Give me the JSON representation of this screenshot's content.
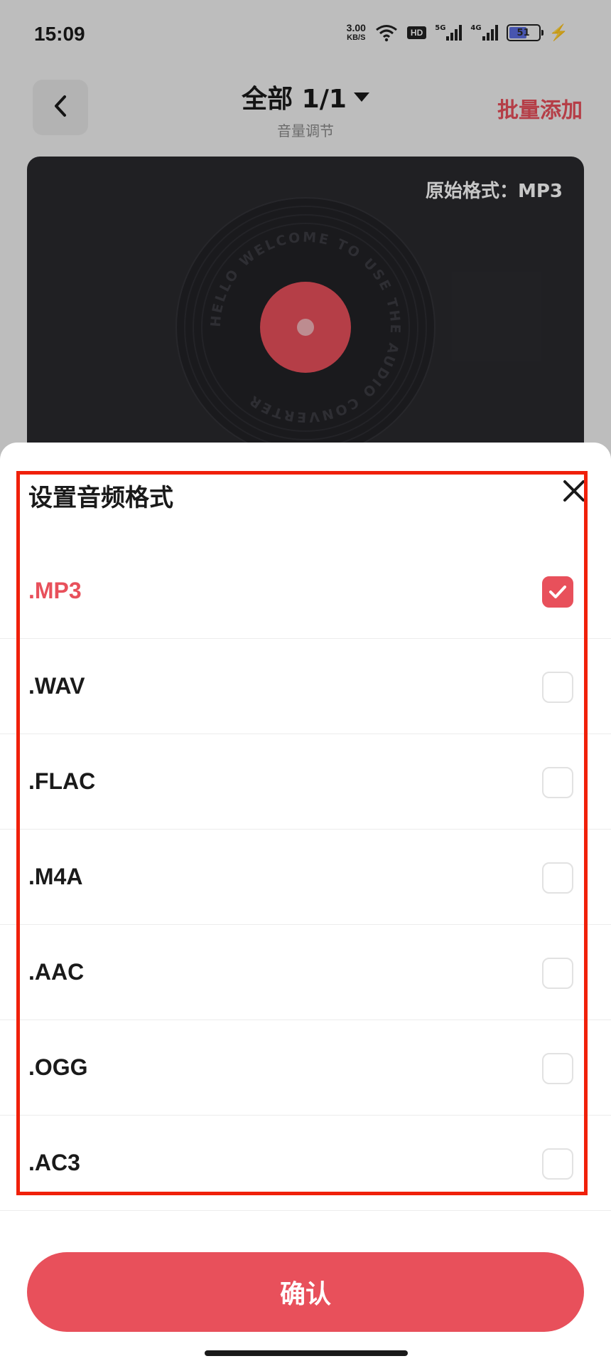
{
  "status_bar": {
    "time": "15:09",
    "net_speed": "3.00",
    "net_unit": "KB/S",
    "hd_label": "HD",
    "sig1_tag": "5G",
    "sig2_tag": "4G",
    "battery": "51"
  },
  "header": {
    "title": "全部 1/1",
    "subtitle": "音量调节",
    "batch_add": "批量添加"
  },
  "player": {
    "original_format": "原始格式：MP3",
    "disc_text": "HELLO WELCOME TO USE THE AUDIO CONVERTER"
  },
  "format_sheet": {
    "title": "设置音频格式",
    "options": [
      {
        "label": ".MP3",
        "checked": true
      },
      {
        "label": ".WAV",
        "checked": false
      },
      {
        "label": ".FLAC",
        "checked": false
      },
      {
        "label": ".M4A",
        "checked": false
      },
      {
        "label": ".AAC",
        "checked": false
      },
      {
        "label": ".OGG",
        "checked": false
      },
      {
        "label": ".AC3",
        "checked": false
      }
    ],
    "confirm_label": "确认"
  },
  "colors": {
    "accent": "#e8505b",
    "highlight_border": "#f0200a"
  }
}
